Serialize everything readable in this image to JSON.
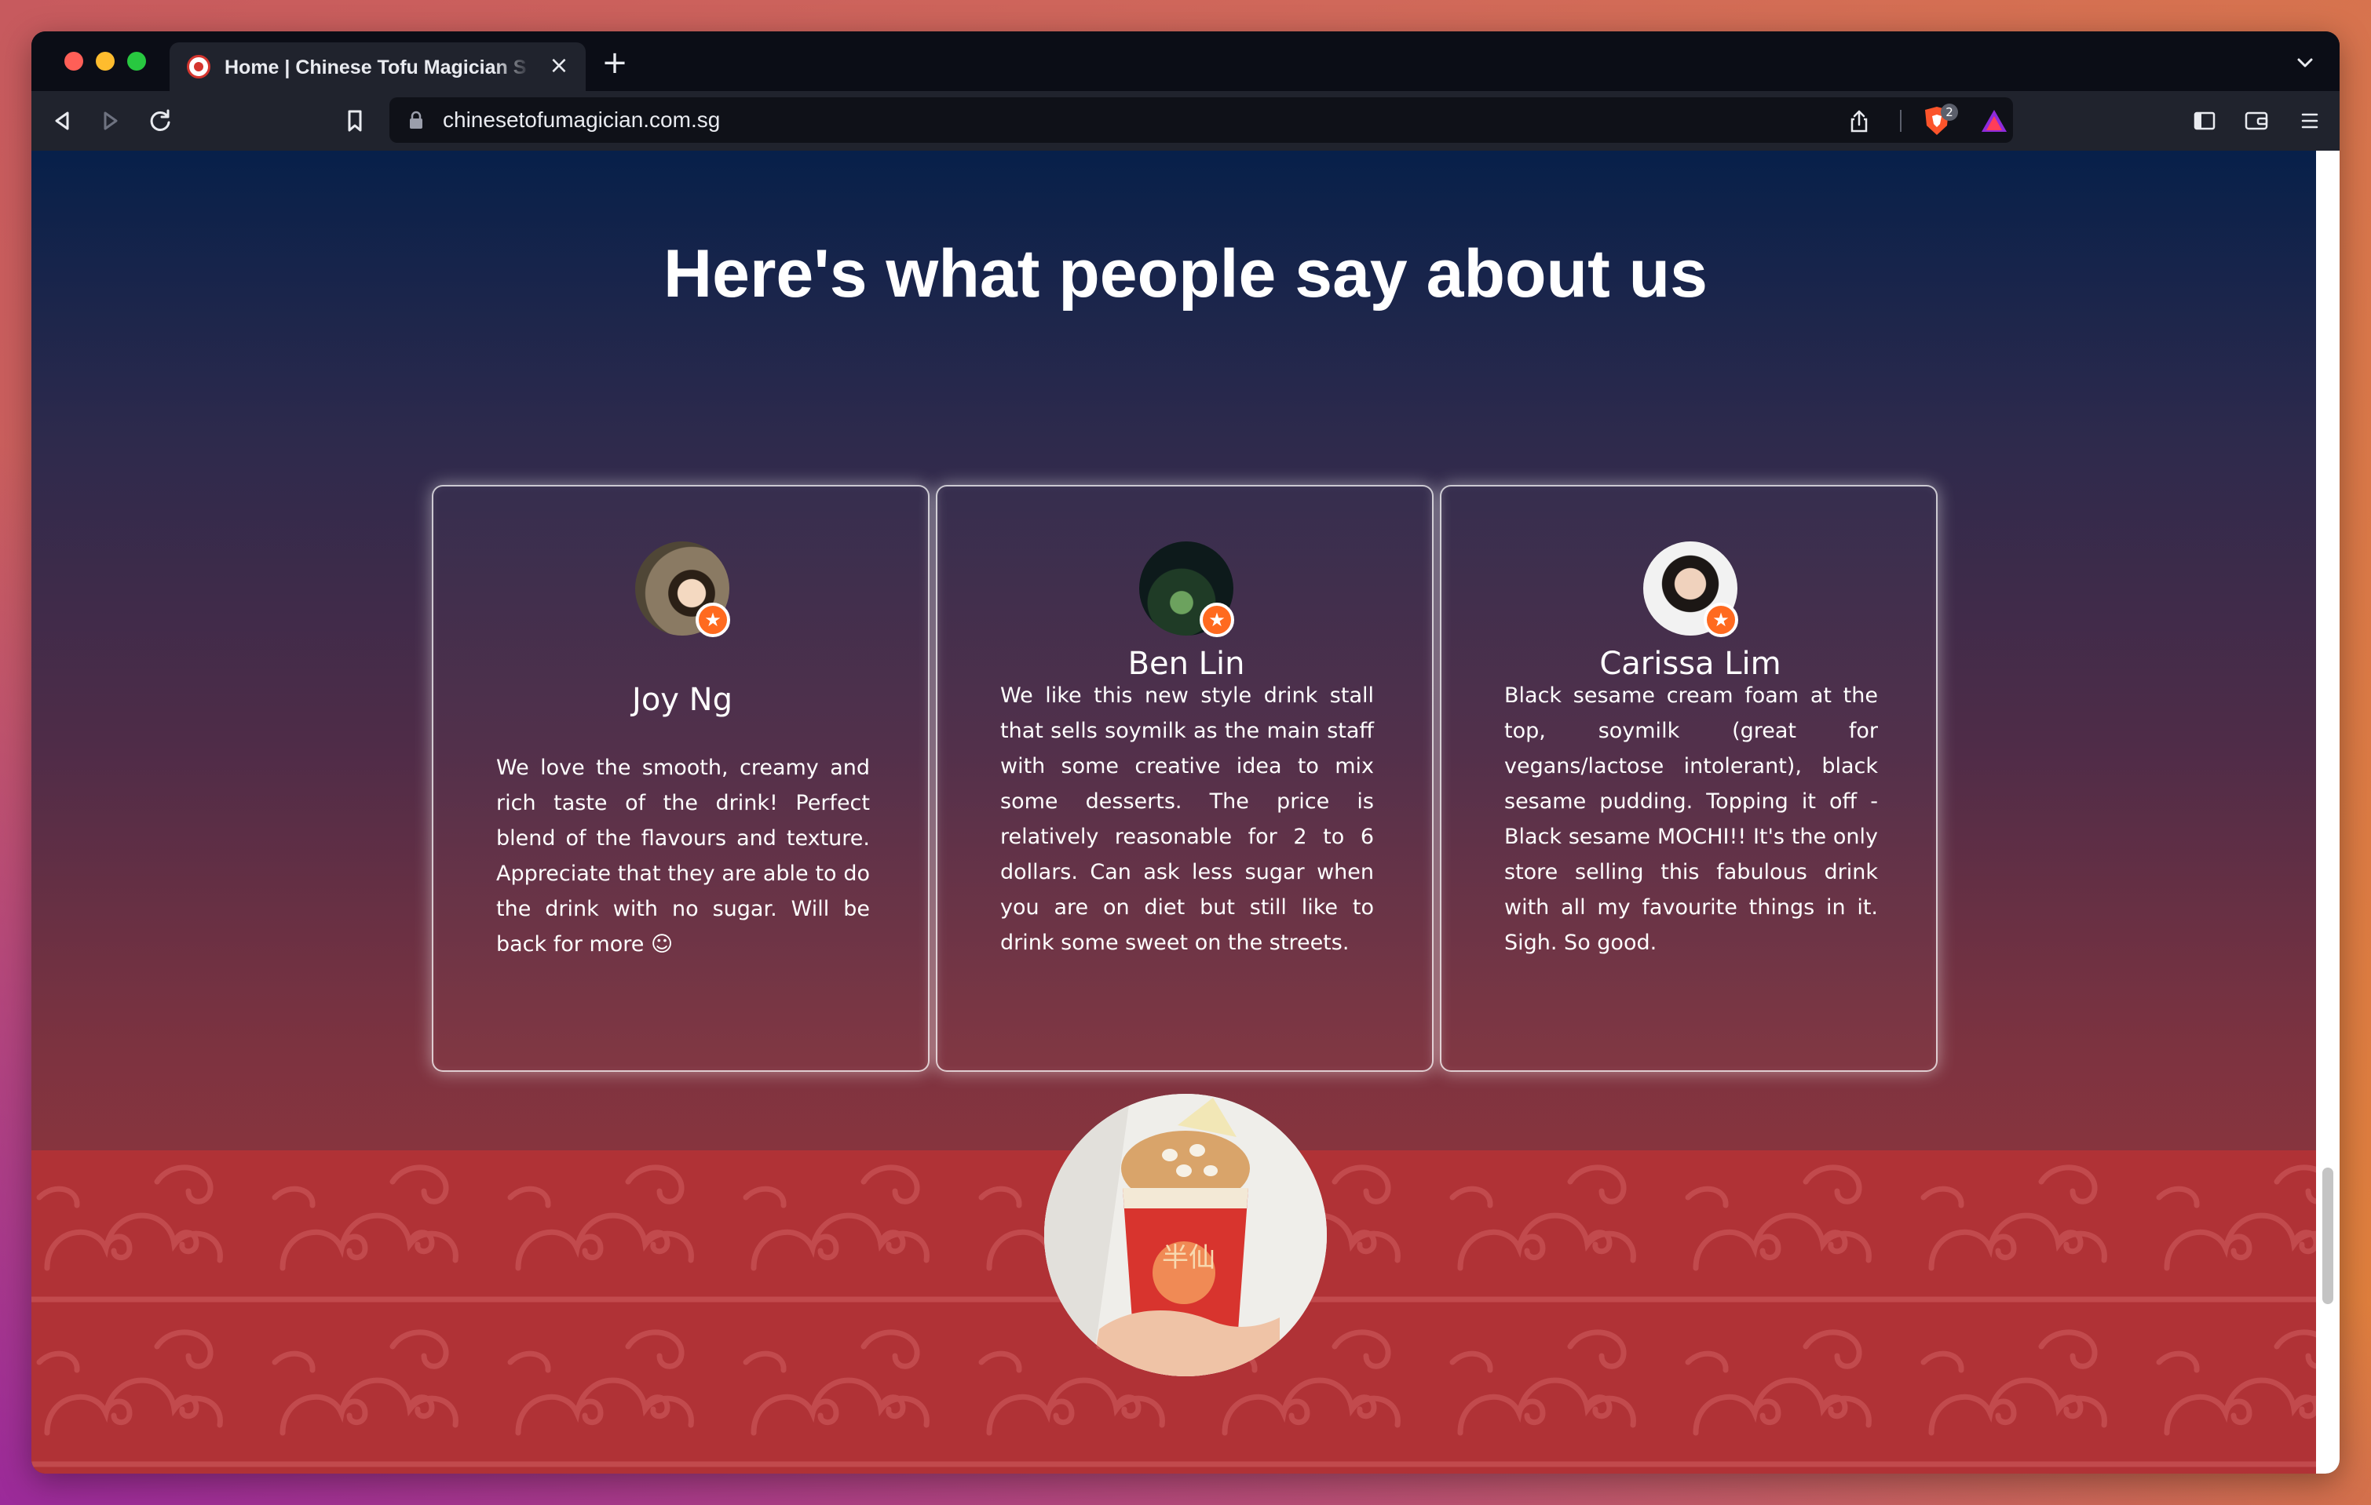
{
  "browser": {
    "tab_title": "Home | Chinese Tofu Magician S",
    "url": "chinesetofumagician.com.sg",
    "shield_count": "2"
  },
  "page": {
    "section_title": "Here's what people say about us"
  },
  "testimonials": [
    {
      "name": "Joy Ng",
      "text": "We love the smooth, creamy and rich taste of the drink! Perfect blend of the flavours and texture. Appreciate that they are able to do the drink with no sugar. Will be back for more ☺"
    },
    {
      "name": "Ben Lin",
      "text": "We like this new style drink stall that sells soymilk as the main staff with some creative idea to mix some desserts. The price is relatively reasonable for 2 to 6 dollars. Can ask less sugar when you are on diet but still like to drink some sweet on the streets."
    },
    {
      "name": "Carissa Lim",
      "text": "Black sesame cream foam at the top, soymilk (great for vegans/lactose intolerant), black sesame pudding. Topping it off - Black sesame MOCHI!! It's the only store selling this fabulous drink with all my favourite things in it. Sigh. So good."
    }
  ],
  "product_cup_text": "半仙",
  "icons": {
    "review_badge": "star-badge-icon",
    "close": "close-icon",
    "new_tab": "plus-icon"
  },
  "colors": {
    "badge_orange": "#ff6a1f",
    "banner_red": "#b03236",
    "title_white": "#ffffff"
  }
}
